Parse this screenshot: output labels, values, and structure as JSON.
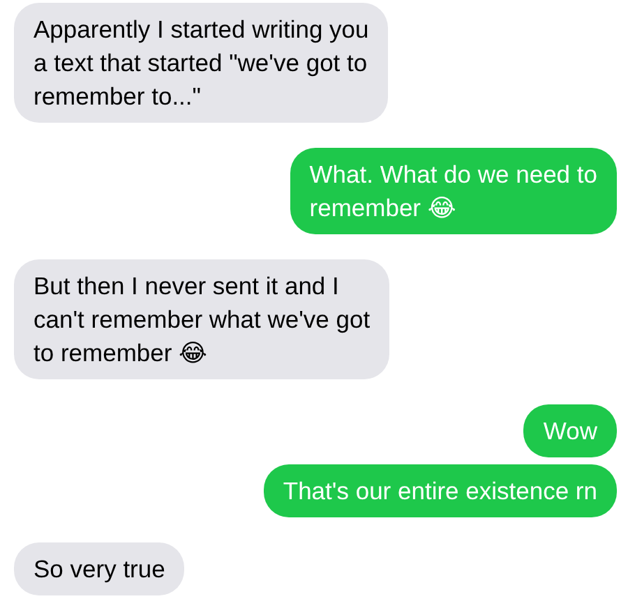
{
  "messages": [
    {
      "kind": "received",
      "text": "Apparently I started writing you\na text that started \"we've got to\nremember to...\""
    },
    {
      "kind": "sent",
      "text": "What. What do we need to\nremember 😂"
    },
    {
      "kind": "received",
      "text": "But then I never sent it and I\ncan't remember what we've got\nto remember 😂"
    },
    {
      "kind": "sent",
      "text": "Wow"
    },
    {
      "kind": "sent",
      "text": "That's our entire existence rn"
    },
    {
      "kind": "received",
      "text": "So very true"
    }
  ]
}
